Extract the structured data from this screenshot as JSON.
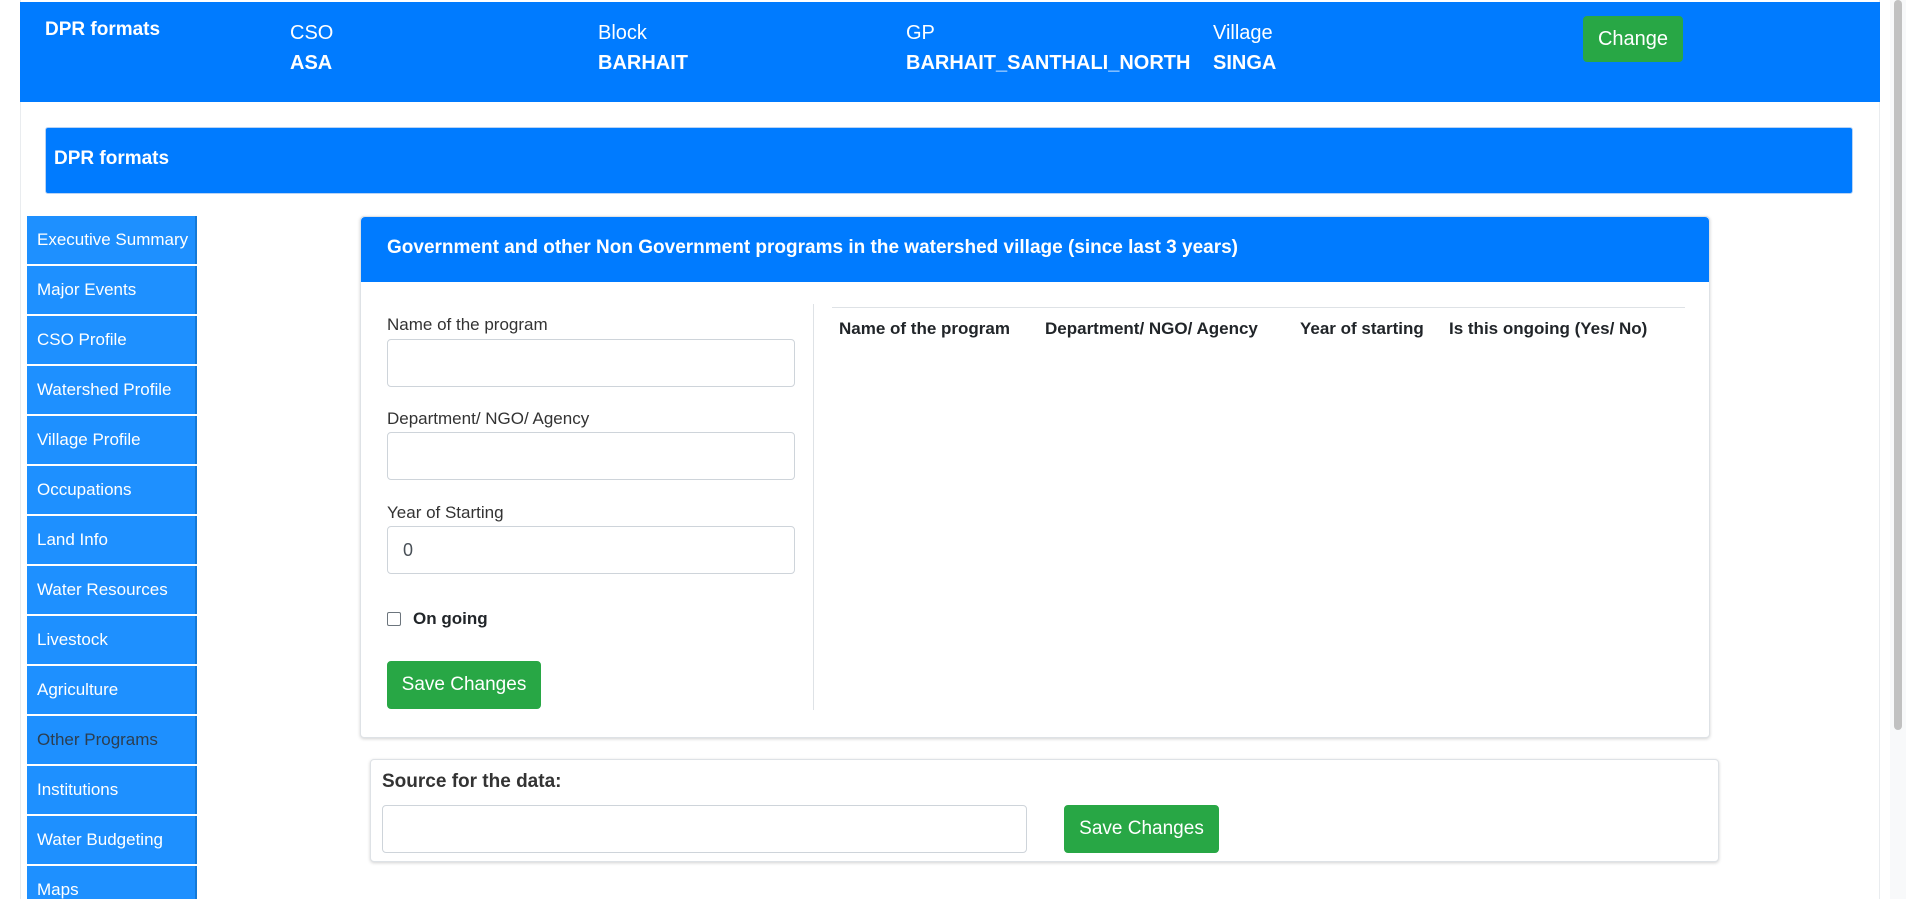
{
  "topbar": {
    "brand": "DPR formats",
    "fields": [
      {
        "label": "CSO",
        "value": "ASA"
      },
      {
        "label": "Block",
        "value": "BARHAIT"
      },
      {
        "label": "GP",
        "value": "BARHAIT_SANTHALI_NORTH"
      },
      {
        "label": "Village",
        "value": "SINGA"
      }
    ],
    "change_label": "Change"
  },
  "section_header": "DPR formats",
  "sidebar": {
    "items": [
      {
        "label": "Executive Summary"
      },
      {
        "label": "Major Events"
      },
      {
        "label": "CSO Profile"
      },
      {
        "label": "Watershed Profile"
      },
      {
        "label": "Village Profile"
      },
      {
        "label": "Occupations"
      },
      {
        "label": "Land Info"
      },
      {
        "label": "Water Resources"
      },
      {
        "label": "Livestock"
      },
      {
        "label": "Agriculture"
      },
      {
        "label": "Other Programs"
      },
      {
        "label": "Institutions"
      },
      {
        "label": "Water Budgeting"
      },
      {
        "label": "Maps"
      }
    ],
    "active_index": 10
  },
  "card": {
    "title": "Government and other Non Government programs in the watershed village (since last 3 years)",
    "form": {
      "program_label": "Name of the program",
      "program_value": "",
      "department_label": "Department/ NGO/ Agency",
      "department_value": "",
      "year_label": "Year of Starting",
      "year_value": "0",
      "ongoing_label": "On going",
      "ongoing_checked": false,
      "save_label": "Save Changes"
    },
    "table": {
      "columns": [
        "Name of the program",
        "Department/ NGO/ Agency",
        "Year of starting",
        "Is this ongoing (Yes/ No)"
      ],
      "rows": []
    }
  },
  "source": {
    "label": "Source for the data:",
    "value": "",
    "save_label": "Save Changes"
  },
  "colors": {
    "primary": "#007bff",
    "success": "#28a745",
    "sidebar": "#1e90ff"
  }
}
